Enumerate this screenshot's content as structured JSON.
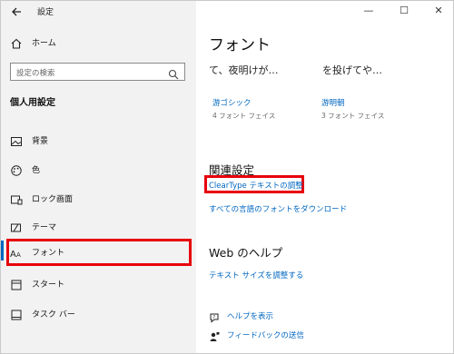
{
  "window": {
    "title": "設定"
  },
  "window_controls": {
    "minimize": "—",
    "maximize": "☐",
    "close": "✕"
  },
  "sidebar": {
    "home": "ホーム",
    "search_placeholder": "設定の検索",
    "section_title": "個人用設定",
    "items": [
      {
        "label": "背景",
        "icon": "picture-icon"
      },
      {
        "label": "色",
        "icon": "palette-icon"
      },
      {
        "label": "ロック画面",
        "icon": "lock-screen-icon"
      },
      {
        "label": "テーマ",
        "icon": "theme-icon"
      },
      {
        "label": "フォント",
        "icon": "font-icon",
        "selected": true
      },
      {
        "label": "スタート",
        "icon": "start-icon"
      },
      {
        "label": "タスク バー",
        "icon": "taskbar-icon"
      }
    ]
  },
  "main": {
    "title": "フォント",
    "previews": [
      {
        "sample": "て、夜明けが…",
        "name": "游ゴシック",
        "faces": "4 フォント フェイス"
      },
      {
        "sample": "を投げてや…",
        "name": "游明朝",
        "faces": "3 フォント フェイス"
      }
    ],
    "related": {
      "heading": "関連設定",
      "links": [
        "ClearType テキストの調整",
        "すべての言語のフォントをダウンロード"
      ]
    },
    "help": {
      "heading": "Web のヘルプ",
      "link": "テキスト サイズを調整する"
    },
    "footer": {
      "help": "ヘルプを表示",
      "feedback": "フィードバックの送信"
    }
  },
  "colors": {
    "accent": "#0067c0",
    "highlight": "#e8000b",
    "sidebar_bg": "#f2f2f2"
  }
}
